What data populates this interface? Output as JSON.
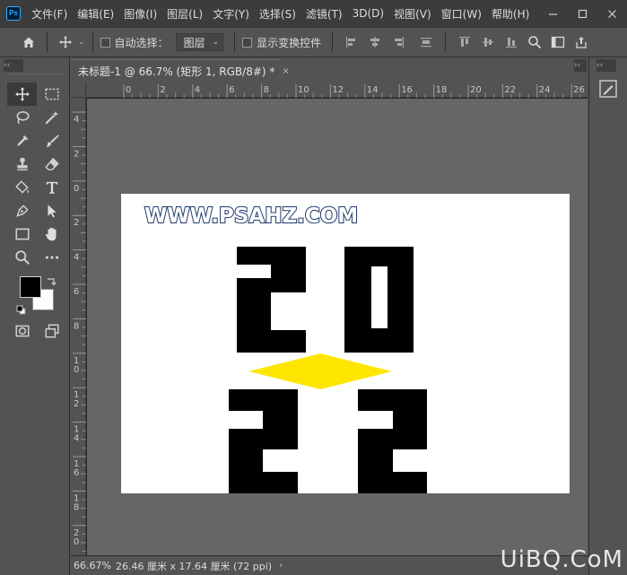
{
  "app": {
    "logo_text": "Ps",
    "menu": [
      "文件(F)",
      "编辑(E)",
      "图像(I)",
      "图层(L)",
      "文字(Y)",
      "选择(S)",
      "滤镜(T)",
      "3D(D)",
      "视图(V)",
      "窗口(W)",
      "帮助(H)"
    ]
  },
  "options_bar": {
    "auto_select_label": "自动选择：",
    "auto_select_target": "图层",
    "show_transform_label": "显示变换控件"
  },
  "panels": {
    "collapse_left": "‹‹",
    "collapse_mid": "››",
    "collapse_right": "‹‹"
  },
  "document": {
    "tab_title": "未标题-1 @ 66.7% (矩形 1, RGB/8#) *",
    "close_symbol": "×",
    "content_text": "WWW.PSAHZ.COM",
    "fill_colors": {
      "black": "#000000",
      "yellow": "#ffe600",
      "page": "#ffffff"
    }
  },
  "ruler": {
    "top_labels": [
      "0",
      "2",
      "4",
      "6",
      "8",
      "10",
      "12",
      "14",
      "16",
      "18",
      "20",
      "22",
      "24",
      "26"
    ],
    "left_labels": [
      "4",
      "2",
      "0",
      "2",
      "4",
      "6",
      "8",
      "1\n0",
      "1\n2",
      "1\n4",
      "1\n6",
      "1\n8",
      "2\n0"
    ]
  },
  "status": {
    "zoom": "66.67%",
    "doc_size": "26.46 厘米 x 17.64 厘米 (72 ppi)",
    "more_arrow": "›"
  },
  "site_watermark": "UiBQ.CoM",
  "colors": {
    "menubar": "#3c3c3c",
    "panel": "#535353",
    "workspace": "#666666",
    "accent": "#31a8ff"
  }
}
